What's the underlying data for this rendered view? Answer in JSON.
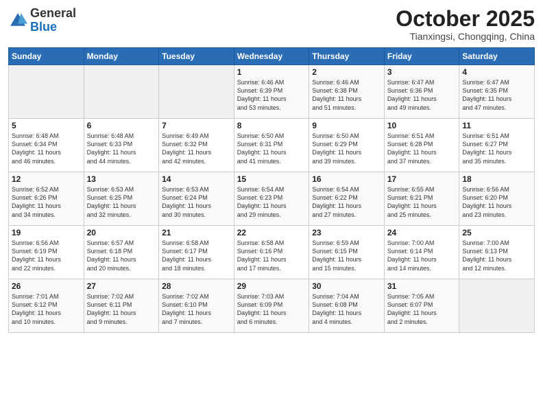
{
  "header": {
    "logo_general": "General",
    "logo_blue": "Blue",
    "month_title": "October 2025",
    "subtitle": "Tianxingsi, Chongqing, China"
  },
  "days_of_week": [
    "Sunday",
    "Monday",
    "Tuesday",
    "Wednesday",
    "Thursday",
    "Friday",
    "Saturday"
  ],
  "weeks": [
    [
      {
        "day": "",
        "info": ""
      },
      {
        "day": "",
        "info": ""
      },
      {
        "day": "",
        "info": ""
      },
      {
        "day": "1",
        "info": "Sunrise: 6:46 AM\nSunset: 6:39 PM\nDaylight: 11 hours\nand 53 minutes."
      },
      {
        "day": "2",
        "info": "Sunrise: 6:46 AM\nSunset: 6:38 PM\nDaylight: 11 hours\nand 51 minutes."
      },
      {
        "day": "3",
        "info": "Sunrise: 6:47 AM\nSunset: 6:36 PM\nDaylight: 11 hours\nand 49 minutes."
      },
      {
        "day": "4",
        "info": "Sunrise: 6:47 AM\nSunset: 6:35 PM\nDaylight: 11 hours\nand 47 minutes."
      }
    ],
    [
      {
        "day": "5",
        "info": "Sunrise: 6:48 AM\nSunset: 6:34 PM\nDaylight: 11 hours\nand 46 minutes."
      },
      {
        "day": "6",
        "info": "Sunrise: 6:48 AM\nSunset: 6:33 PM\nDaylight: 11 hours\nand 44 minutes."
      },
      {
        "day": "7",
        "info": "Sunrise: 6:49 AM\nSunset: 6:32 PM\nDaylight: 11 hours\nand 42 minutes."
      },
      {
        "day": "8",
        "info": "Sunrise: 6:50 AM\nSunset: 6:31 PM\nDaylight: 11 hours\nand 41 minutes."
      },
      {
        "day": "9",
        "info": "Sunrise: 6:50 AM\nSunset: 6:29 PM\nDaylight: 11 hours\nand 39 minutes."
      },
      {
        "day": "10",
        "info": "Sunrise: 6:51 AM\nSunset: 6:28 PM\nDaylight: 11 hours\nand 37 minutes."
      },
      {
        "day": "11",
        "info": "Sunrise: 6:51 AM\nSunset: 6:27 PM\nDaylight: 11 hours\nand 35 minutes."
      }
    ],
    [
      {
        "day": "12",
        "info": "Sunrise: 6:52 AM\nSunset: 6:26 PM\nDaylight: 11 hours\nand 34 minutes."
      },
      {
        "day": "13",
        "info": "Sunrise: 6:53 AM\nSunset: 6:25 PM\nDaylight: 11 hours\nand 32 minutes."
      },
      {
        "day": "14",
        "info": "Sunrise: 6:53 AM\nSunset: 6:24 PM\nDaylight: 11 hours\nand 30 minutes."
      },
      {
        "day": "15",
        "info": "Sunrise: 6:54 AM\nSunset: 6:23 PM\nDaylight: 11 hours\nand 29 minutes."
      },
      {
        "day": "16",
        "info": "Sunrise: 6:54 AM\nSunset: 6:22 PM\nDaylight: 11 hours\nand 27 minutes."
      },
      {
        "day": "17",
        "info": "Sunrise: 6:55 AM\nSunset: 6:21 PM\nDaylight: 11 hours\nand 25 minutes."
      },
      {
        "day": "18",
        "info": "Sunrise: 6:56 AM\nSunset: 6:20 PM\nDaylight: 11 hours\nand 23 minutes."
      }
    ],
    [
      {
        "day": "19",
        "info": "Sunrise: 6:56 AM\nSunset: 6:19 PM\nDaylight: 11 hours\nand 22 minutes."
      },
      {
        "day": "20",
        "info": "Sunrise: 6:57 AM\nSunset: 6:18 PM\nDaylight: 11 hours\nand 20 minutes."
      },
      {
        "day": "21",
        "info": "Sunrise: 6:58 AM\nSunset: 6:17 PM\nDaylight: 11 hours\nand 18 minutes."
      },
      {
        "day": "22",
        "info": "Sunrise: 6:58 AM\nSunset: 6:16 PM\nDaylight: 11 hours\nand 17 minutes."
      },
      {
        "day": "23",
        "info": "Sunrise: 6:59 AM\nSunset: 6:15 PM\nDaylight: 11 hours\nand 15 minutes."
      },
      {
        "day": "24",
        "info": "Sunrise: 7:00 AM\nSunset: 6:14 PM\nDaylight: 11 hours\nand 14 minutes."
      },
      {
        "day": "25",
        "info": "Sunrise: 7:00 AM\nSunset: 6:13 PM\nDaylight: 11 hours\nand 12 minutes."
      }
    ],
    [
      {
        "day": "26",
        "info": "Sunrise: 7:01 AM\nSunset: 6:12 PM\nDaylight: 11 hours\nand 10 minutes."
      },
      {
        "day": "27",
        "info": "Sunrise: 7:02 AM\nSunset: 6:11 PM\nDaylight: 11 hours\nand 9 minutes."
      },
      {
        "day": "28",
        "info": "Sunrise: 7:02 AM\nSunset: 6:10 PM\nDaylight: 11 hours\nand 7 minutes."
      },
      {
        "day": "29",
        "info": "Sunrise: 7:03 AM\nSunset: 6:09 PM\nDaylight: 11 hours\nand 6 minutes."
      },
      {
        "day": "30",
        "info": "Sunrise: 7:04 AM\nSunset: 6:08 PM\nDaylight: 11 hours\nand 4 minutes."
      },
      {
        "day": "31",
        "info": "Sunrise: 7:05 AM\nSunset: 6:07 PM\nDaylight: 11 hours\nand 2 minutes."
      },
      {
        "day": "",
        "info": ""
      }
    ]
  ]
}
